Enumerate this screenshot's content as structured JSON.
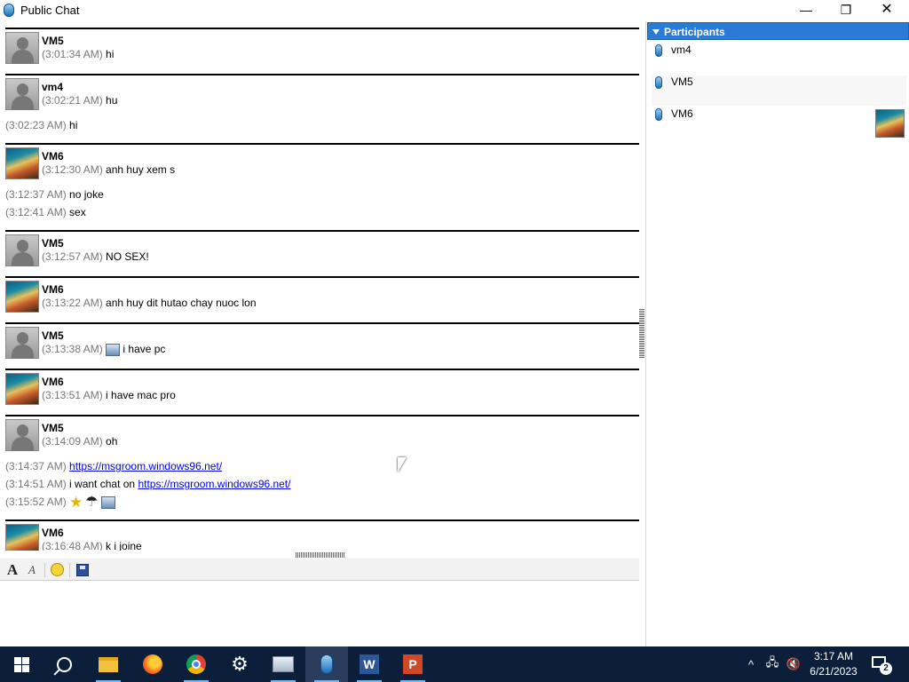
{
  "window": {
    "title": "Public Chat",
    "minimize_glyph": "—",
    "maximize_glyph": "❐",
    "close_glyph": "✕"
  },
  "chat": {
    "blocks": [
      {
        "sender": "VM5",
        "avatar": "default-user-avatar",
        "lines": [
          {
            "time": "(3:01:34 AM)",
            "text": "hi"
          }
        ]
      },
      {
        "sender": "vm4",
        "avatar": "default-user-avatar",
        "lines": [
          {
            "time": "(3:02:21 AM)",
            "text": "hu"
          },
          {
            "time": "(3:02:23 AM)",
            "text": "hi"
          }
        ]
      },
      {
        "sender": "VM6",
        "avatar": "stairs-avatar",
        "lines": [
          {
            "time": "(3:12:30 AM)",
            "text": "anh huy xem s"
          },
          {
            "time": "(3:12:37 AM)",
            "text": "no joke"
          },
          {
            "time": "(3:12:41 AM)",
            "text": "sex"
          }
        ]
      },
      {
        "sender": "VM5",
        "avatar": "default-user-avatar",
        "lines": [
          {
            "time": "(3:12:57 AM)",
            "text": "NO SEX!"
          }
        ]
      },
      {
        "sender": "VM6",
        "avatar": "stairs-avatar",
        "lines": [
          {
            "time": "(3:13:22 AM)",
            "text": "anh huy dit hutao chay nuoc lon"
          }
        ]
      },
      {
        "sender": "VM5",
        "avatar": "default-user-avatar",
        "lines": [
          {
            "time": "(3:13:38 AM)",
            "text": "i have pc",
            "emoticon": "computer-emoticon"
          }
        ]
      },
      {
        "sender": "VM6",
        "avatar": "stairs-avatar",
        "lines": [
          {
            "time": "(3:13:51 AM)",
            "text": "i have mac pro"
          }
        ]
      },
      {
        "sender": "VM5",
        "avatar": "default-user-avatar",
        "lines": [
          {
            "time": "(3:14:09 AM)",
            "text": "oh"
          },
          {
            "time": "(3:14:37 AM)",
            "link": "https://msgroom.windows96.net/"
          },
          {
            "time": "(3:14:51 AM)",
            "text": "i want chat on",
            "link": "https://msgroom.windows96.net/"
          },
          {
            "time": "(3:15:52 AM)",
            "emoticons": [
              "star-emoticon",
              "umbrella-emoticon",
              "computer-emoticon"
            ]
          }
        ]
      },
      {
        "sender": "VM6",
        "avatar": "stairs-avatar",
        "lines": [
          {
            "time": "(3:16:48 AM)",
            "text": "k i joine"
          }
        ]
      }
    ]
  },
  "toolbar": {
    "font_glyph": "A",
    "effect_glyph": "A"
  },
  "input": {
    "value": ""
  },
  "participants": {
    "header": "Participants",
    "items": [
      {
        "name": "vm4"
      },
      {
        "name": "VM5"
      },
      {
        "name": "VM6",
        "avatar": "stairs-avatar"
      }
    ]
  },
  "taskbar": {
    "apps": [
      "start",
      "search",
      "file-explorer",
      "firefox",
      "chrome",
      "settings",
      "computer",
      "messenger",
      "word",
      "powerpoint"
    ],
    "word_letter": "W",
    "ppt_letter": "P",
    "tray": {
      "chevron": "^",
      "time": "3:17 AM",
      "date": "6/21/2023",
      "notification_count": "2"
    }
  },
  "colors": {
    "participants_header": "#2b7ad6",
    "link": "#0000ee",
    "timestamp": "#777777",
    "taskbar": "#0b1f3a"
  }
}
